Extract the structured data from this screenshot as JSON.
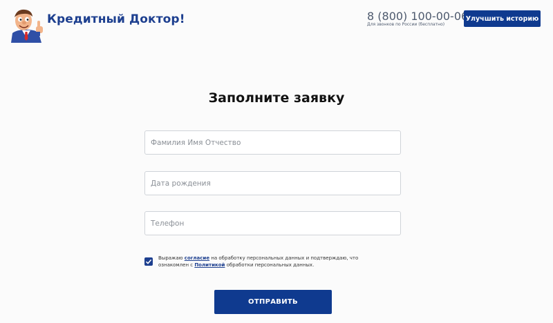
{
  "header": {
    "brand": "Кредитный Доктор!",
    "phone": "8 (800) 100-00-06",
    "phone_note": "Для звонков по России (бесплатно)",
    "improve_button": "Улучшить историю",
    "logo_icon": "doctor-mascot-thumbs-up"
  },
  "form": {
    "title": "Заполните заявку",
    "fields": [
      {
        "placeholder": "Фамилия Имя Отчество",
        "value": ""
      },
      {
        "placeholder": "Дата рождения",
        "value": ""
      },
      {
        "placeholder": "Телефон",
        "value": ""
      }
    ],
    "consent": {
      "checked": true,
      "text_1": "Выражаю",
      "link_1": "согласие",
      "text_2": "на обработку персональных данных и подтверждаю, что ознакомлен с",
      "link_2": "Политикой",
      "text_3": "обработки персональных данных."
    },
    "submit_label": "ОТПРАВИТЬ"
  },
  "colors": {
    "brand": "#1d3f8f",
    "button": "#0f3a8f",
    "phone": "#4e5a6e",
    "background": "#fbfbfb"
  }
}
